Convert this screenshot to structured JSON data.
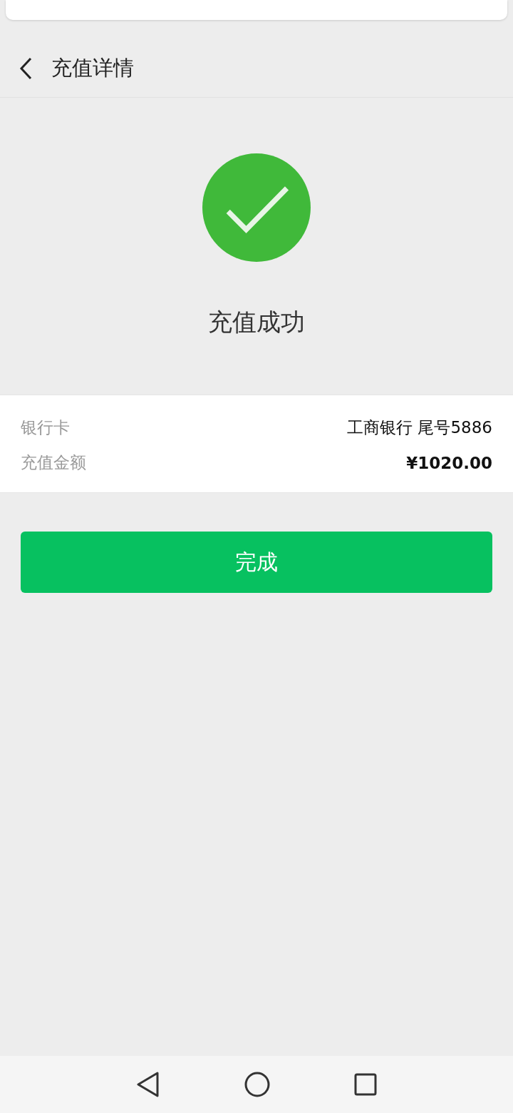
{
  "header": {
    "title": "充值详情"
  },
  "result": {
    "status": "充值成功"
  },
  "details": [
    {
      "label": "银行卡",
      "value": "工商银行 尾号5886",
      "bold": false
    },
    {
      "label": "充值金额",
      "value": "¥1020.00",
      "bold": true
    }
  ],
  "done_button": "完成"
}
